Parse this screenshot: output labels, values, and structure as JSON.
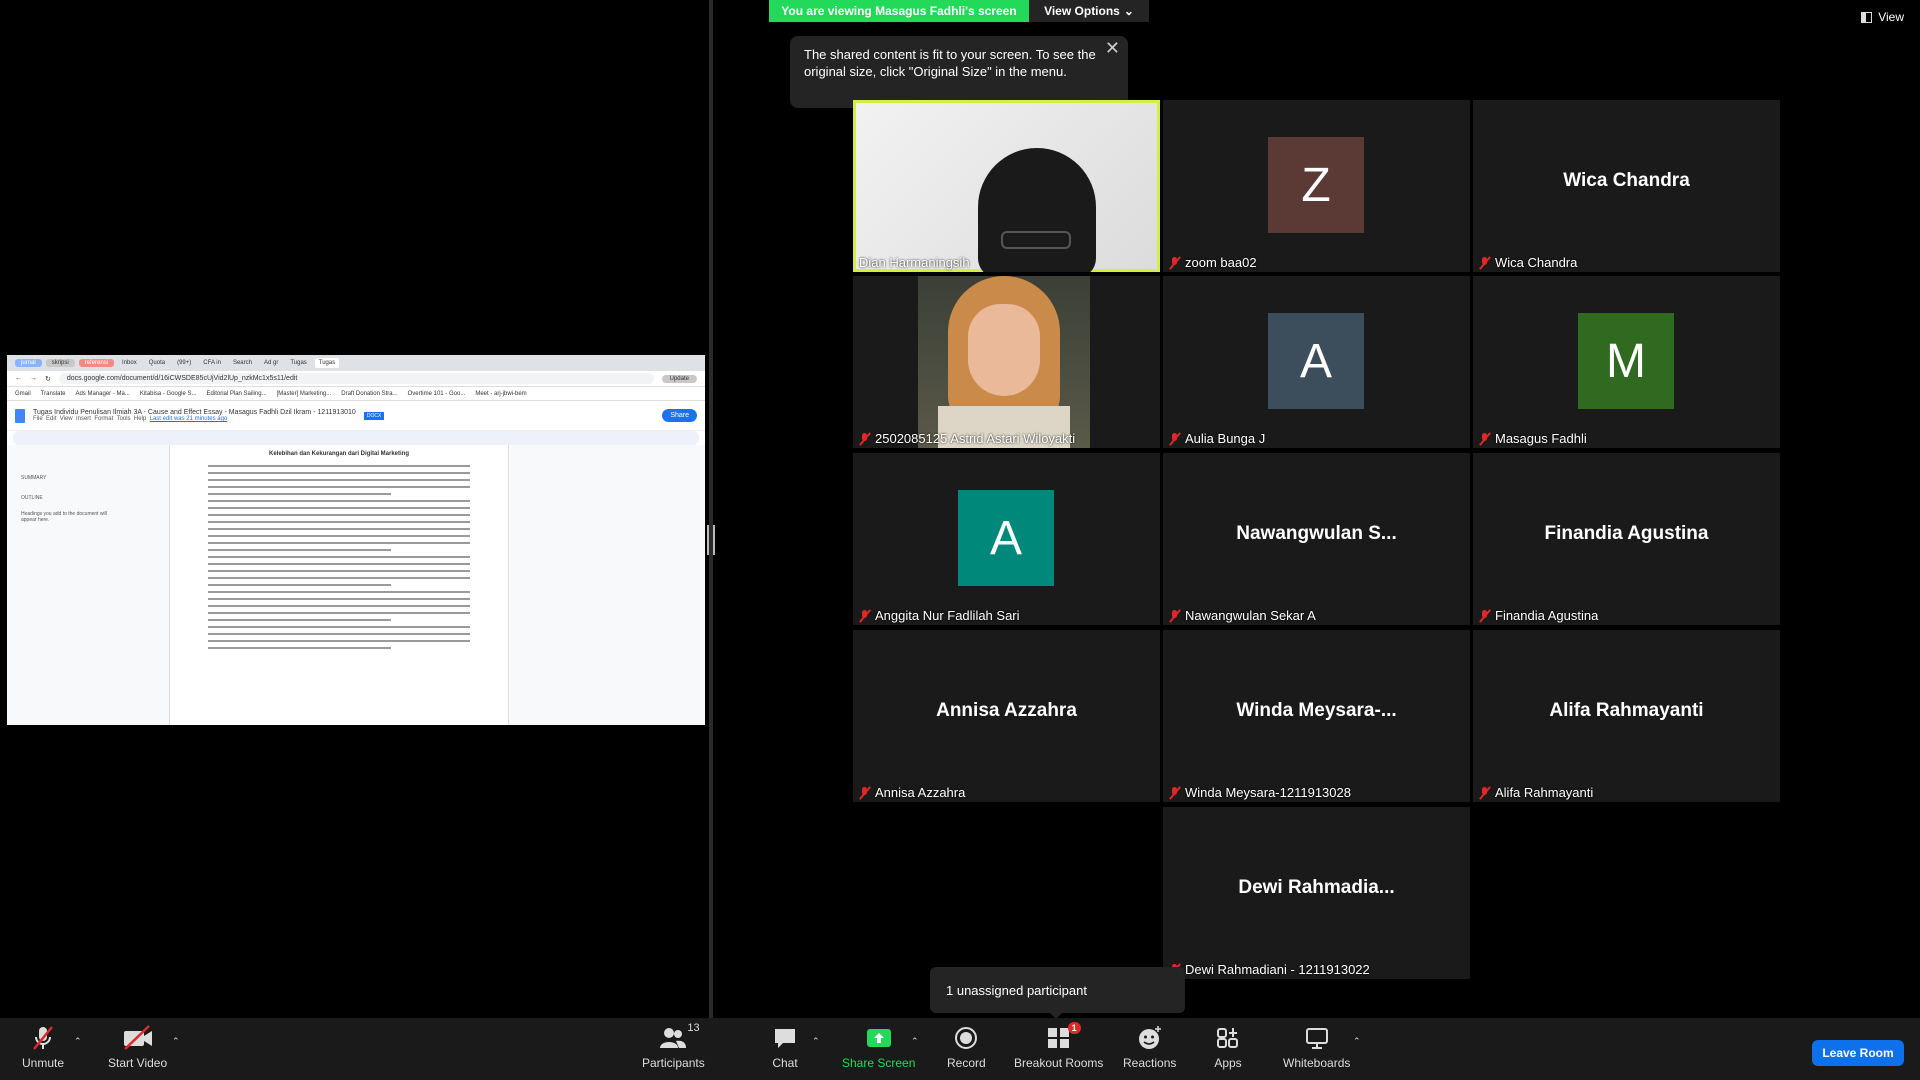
{
  "banner": {
    "viewing_text": "You are viewing Masagus Fadhli's screen",
    "view_options_label": "View Options"
  },
  "tooltip": {
    "text": "The shared content is fit to your screen. To see the original size, click \"Original Size\" in the menu."
  },
  "view_button_label": "View",
  "shared_screen": {
    "tabs": [
      "jurnal",
      "skripsi",
      "referensi",
      "Inbox",
      "Quota",
      "(99+)",
      "CFA in",
      "Search",
      "Ad gr",
      "Tugas",
      "Tugas"
    ],
    "url": "docs.google.com/document/d/16iCWSDE85cUjVid2lUp_nzkMc1x5s11/edit",
    "update_label": "Update",
    "bookmarks": [
      "Gmail",
      "Translate",
      "Ads Manager - Ma...",
      "Kitabisa - Google S...",
      "Editorial Plan Sailing...",
      "[Master] Marketing...",
      "Draft Donation Stra...",
      "Overtime 101 - Goo...",
      "Meet - arj-jbwi-bem"
    ],
    "doc_title": "Tugas Individu Penulisan Ilmiah 3A - Cause and Effect Essay - Masagus Fadhli Dzil Ikram - 1211913010",
    "doc_badge": "DOCX",
    "menu": [
      "File",
      "Edit",
      "View",
      "Insert",
      "Format",
      "Tools",
      "Help"
    ],
    "last_edit": "Last edit was 21 minutes ago",
    "share_label": "Share",
    "outline_summary": "SUMMARY",
    "outline_heading": "OUTLINE",
    "outline_hint": "Headings you add to the document will appear here.",
    "page_title": "Kelebihan dan Kekurangan dari Digital Marketing"
  },
  "participants": [
    {
      "name": "Dian Harmaningsih",
      "kind": "video",
      "muted": false,
      "active": true
    },
    {
      "name": "zoom baa02",
      "kind": "letter",
      "letter": "Z",
      "color": "#5b3a36",
      "muted": true
    },
    {
      "name": "Wica Chandra",
      "kind": "name",
      "display": "Wica Chandra",
      "muted": true
    },
    {
      "name": "2502085125 Astrid Astari Wiloyakti",
      "kind": "photo",
      "muted": true
    },
    {
      "name": "Aulia Bunga J",
      "kind": "letter",
      "letter": "A",
      "color": "#3c4e5c",
      "muted": true
    },
    {
      "name": "Masagus Fadhli",
      "kind": "letter",
      "letter": "M",
      "color": "#2f6a20",
      "muted": true
    },
    {
      "name": "Anggita Nur Fadlilah Sari",
      "kind": "letter",
      "letter": "A",
      "color": "#00897b",
      "muted": true
    },
    {
      "name": "Nawangwulan Sekar A",
      "kind": "name",
      "display": "Nawangwulan S...",
      "muted": true
    },
    {
      "name": "Finandia Agustina",
      "kind": "name",
      "display": "Finandia Agustina",
      "muted": true
    },
    {
      "name": "Annisa Azzahra",
      "kind": "name",
      "display": "Annisa Azzahra",
      "muted": true
    },
    {
      "name": "Winda Meysara-1211913028",
      "kind": "name",
      "display": "Winda Meysara-...",
      "muted": true
    },
    {
      "name": "Alifa Rahmayanti",
      "kind": "name",
      "display": "Alifa Rahmayanti",
      "muted": true
    },
    {
      "name": "Dewi Rahmadiani - 1211913022",
      "kind": "name",
      "display": "Dewi Rahmadia...",
      "muted": true
    }
  ],
  "toast": {
    "text": "1 unassigned participant"
  },
  "toolbar": {
    "unmute": "Unmute",
    "start_video": "Start Video",
    "participants": "Participants",
    "participants_count": "13",
    "chat": "Chat",
    "share_screen": "Share Screen",
    "record": "Record",
    "breakout_rooms": "Breakout Rooms",
    "breakout_badge": "1",
    "reactions": "Reactions",
    "apps": "Apps",
    "whiteboards": "Whiteboards",
    "leave_room": "Leave Room"
  },
  "colors": {
    "accent_green": "#23d959",
    "active_speaker": "#d4ee48",
    "leave_blue": "#0e71eb",
    "muted_red": "#e02828"
  }
}
